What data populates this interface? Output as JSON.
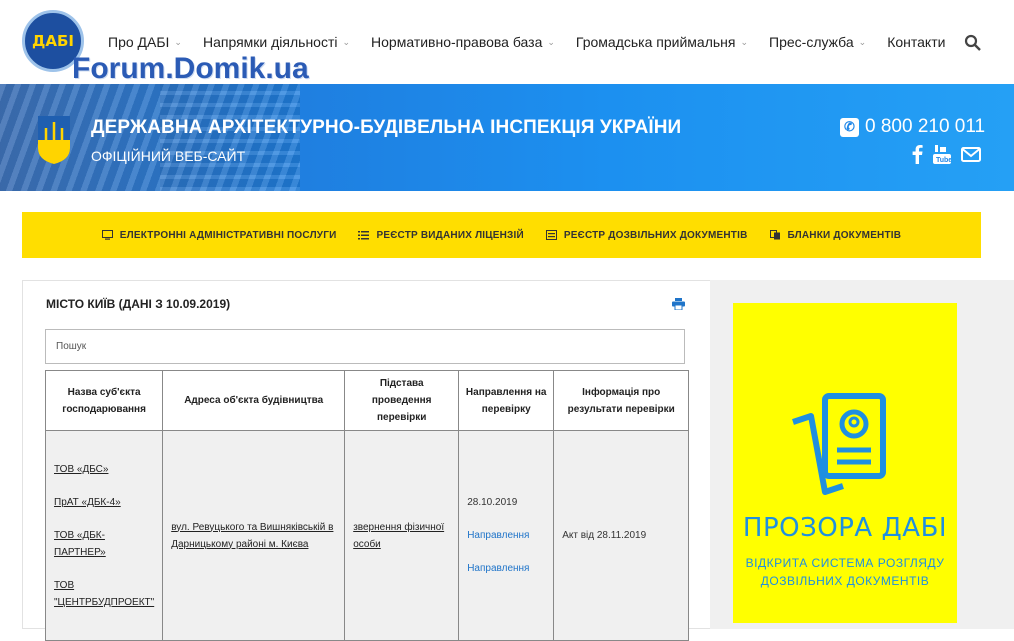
{
  "header": {
    "logo_text": "ДАБІ",
    "watermark": "Forum.Domik.ua",
    "nav": [
      {
        "label": "Про ДАБІ",
        "dropdown": true
      },
      {
        "label": "Напрямки діяльності",
        "dropdown": true
      },
      {
        "label": "Нормативно-правова база",
        "dropdown": true
      },
      {
        "label": "Громадська приймальня",
        "dropdown": true
      },
      {
        "label": "Прес-служба",
        "dropdown": true
      },
      {
        "label": "Контакти",
        "dropdown": false
      }
    ]
  },
  "banner": {
    "title": "ДЕРЖАВНА АРХІТЕКТУРНО-БУДІВЕЛЬНА ІНСПЕКЦІЯ УКРАЇНИ",
    "subtitle": "ОФІЦІЙНИЙ ВЕБ-САЙТ",
    "phone": "0 800 210 011",
    "social": [
      "facebook-icon",
      "youtube-icon",
      "mail-icon"
    ]
  },
  "quicklinks": [
    {
      "label": "ЕЛЕКТРОННІ АДМІНІСТРАТИВНІ ПОСЛУГИ",
      "icon": "monitor-icon"
    },
    {
      "label": "РЕЄСТР ВИДАНИХ ЛІЦЕНЗІЙ",
      "icon": "list-icon"
    },
    {
      "label": "РЕЄСТР ДОЗВІЛЬНИХ ДОКУМЕНТІВ",
      "icon": "register-icon"
    },
    {
      "label": "БЛАНКИ ДОКУМЕНТІВ",
      "icon": "copy-icon"
    }
  ],
  "content": {
    "title": "МІСТО КИЇВ (ДАНІ З 10.09.2019)",
    "search_placeholder": "Пошук",
    "table": {
      "headers": [
        "Назва суб'єкта господарювання",
        "Адреса об'єкта будівництва",
        "Підстава проведення перевірки",
        "Направлення на перевірку",
        "Інформація про результати перевірки"
      ],
      "row": {
        "companies": [
          "ТОВ «ДБС»",
          "ПрАТ «ДБК-4»",
          "ТОВ «ДБК-ПАРТНЕР»",
          "ТОВ \"ЦЕНТРБУДПРОЕКТ\""
        ],
        "address": "вул. Ревуцького та Вишняківській в Дарницькому районі м. Києва",
        "basis": "звернення фізичної особи",
        "date": "28.10.2019",
        "directions": [
          "Направлення",
          "Направлення"
        ],
        "result": "Акт від 28.11.2019"
      }
    }
  },
  "promo": {
    "title": "ПРОЗОРА ДАБІ",
    "subtitle": "ВІДКРИТА СИСТЕМА РОЗГЛЯДУ ДОЗВІЛЬНИХ ДОКУМЕНТІВ",
    "color": "#1f8fe0",
    "bg": "#ffff00"
  }
}
